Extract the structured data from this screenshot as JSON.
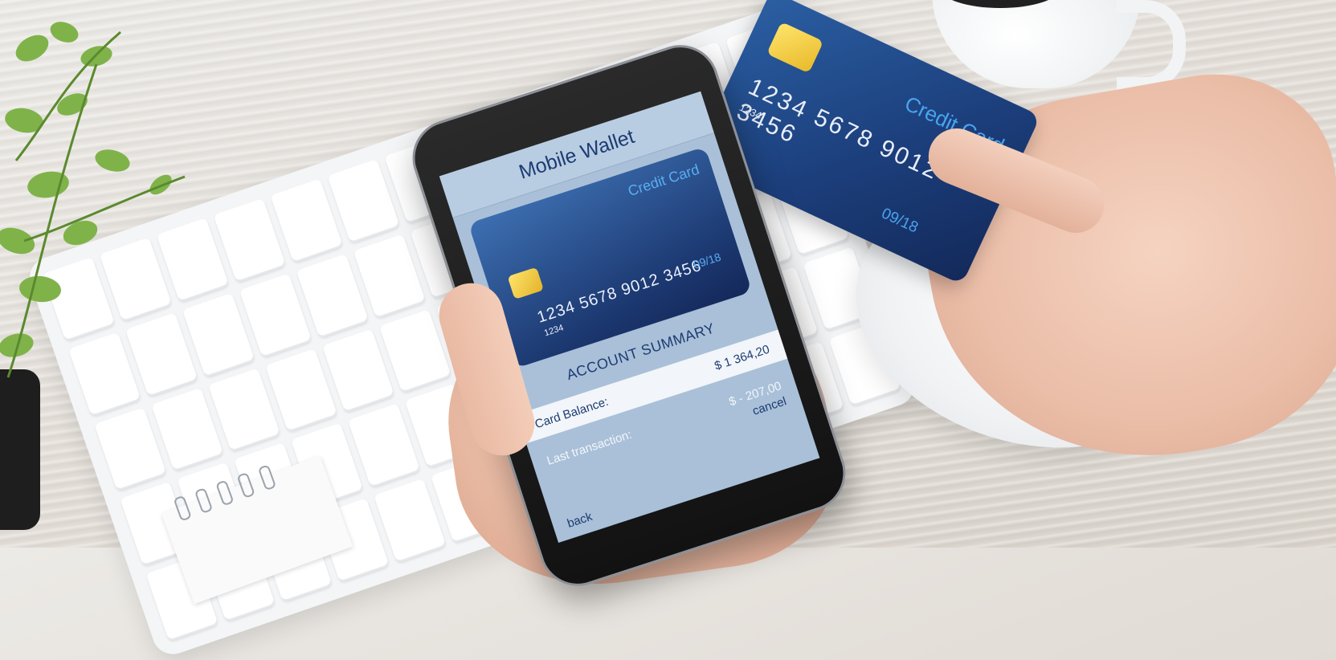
{
  "physical_card": {
    "brand": "Credit Card",
    "number": "1234 5678 9012 3456",
    "small_number": "1234",
    "expiry": "09/18"
  },
  "app": {
    "title": "Mobile Wallet",
    "card": {
      "brand": "Credit Card",
      "number": "1234 5678 9012 3456",
      "small_number": "1234",
      "expiry": "09/18"
    },
    "summary_title": "ACCOUNT SUMMARY",
    "balance_label": "Card Balance:",
    "balance_value": "$ 1 364,20",
    "last_label": "Last transaction:",
    "last_value": "$ - 207,00",
    "cancel_label": "cancel",
    "back_label": "back"
  },
  "colors": {
    "card_blue": "#1c3f7c",
    "accent_text": "#1d3c73",
    "screen_bg": "#a9c0d8",
    "chip_gold": "#e8b92a"
  },
  "icons": {
    "chip": "card-chip-icon"
  }
}
